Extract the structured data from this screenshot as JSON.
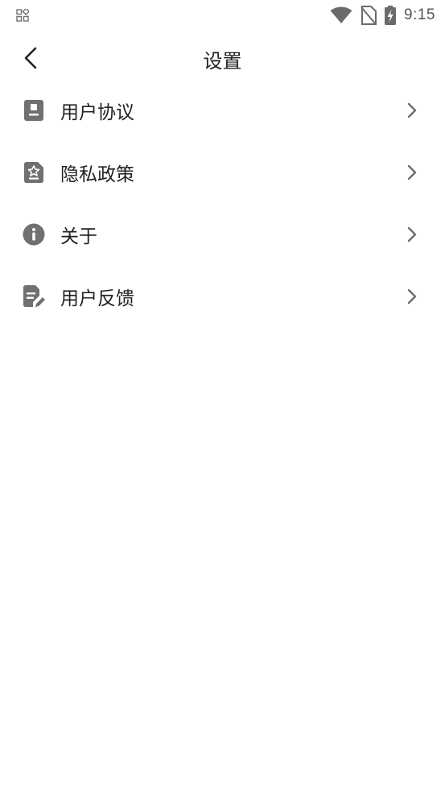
{
  "status_bar": {
    "time": "9:15",
    "icons": [
      "apps-grid-icon",
      "wifi-icon",
      "no-sim-icon",
      "battery-charging-icon"
    ]
  },
  "header": {
    "title": "设置",
    "back_icon": "chevron-left-icon"
  },
  "settings": {
    "items": [
      {
        "label": "用户协议",
        "icon": "document-icon"
      },
      {
        "label": "隐私政策",
        "icon": "privacy-document-icon"
      },
      {
        "label": "关于",
        "icon": "info-icon"
      },
      {
        "label": "用户反馈",
        "icon": "feedback-edit-icon"
      }
    ]
  },
  "colors": {
    "icon_gray": "#707070",
    "chevron_gray": "#6e6e6e",
    "text": "#222222",
    "background": "#ffffff"
  }
}
